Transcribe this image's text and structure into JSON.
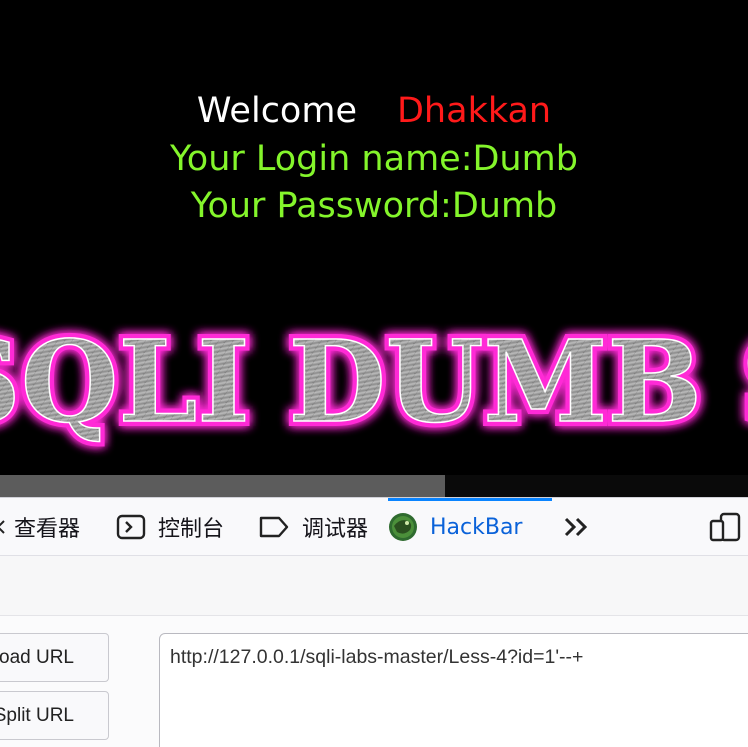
{
  "page": {
    "welcome_word": "Welcome",
    "welcome_name": "Dhakkan",
    "login_line": "Your Login name:Dumb",
    "password_line": "Your Password:Dumb",
    "banner_text": "SQLI DUMB S",
    "colors": {
      "background": "#000000",
      "welcome": "#ffffff",
      "name": "#ff1a1a",
      "info": "#84f52b",
      "banner_glow": "#ff2bd6",
      "banner_fill": "#9a9a9a"
    }
  },
  "devtools": {
    "tabs": [
      {
        "label": "查看器",
        "icon": "inspector-icon"
      },
      {
        "label": "控制台",
        "icon": "console-icon"
      },
      {
        "label": "调试器",
        "icon": "debugger-icon"
      },
      {
        "label": "HackBar",
        "icon": "hackbar-icon",
        "active": true
      }
    ],
    "more_icon": "chevrons-right-icon",
    "responsive_icon": "responsive-design-icon",
    "accent_color": "#0a84ff"
  },
  "hackbar": {
    "load_url_label": "Load URL",
    "split_url_label": "Split URL",
    "url_value": "http://127.0.0.1/sqli-labs-master/Less-4?id=1'--+"
  }
}
